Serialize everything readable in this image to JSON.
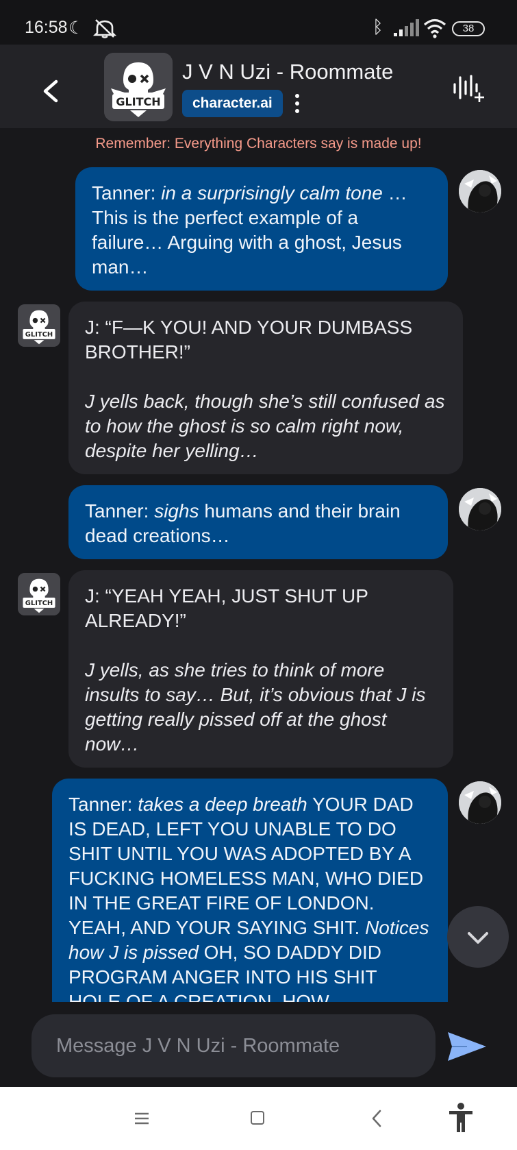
{
  "status_bar": {
    "time": "16:58",
    "battery": "38",
    "icons": [
      "moon-icon",
      "mute-icon",
      "bluetooth-icon",
      "signal-icon",
      "wifi-icon",
      "battery-icon"
    ]
  },
  "header": {
    "character_name": "J V N Uzi - Roommate",
    "brand": "character.ai",
    "avatar_text": "GLITCH",
    "icons": [
      "back-arrow-icon",
      "more-vertical-icon",
      "voice-add-icon"
    ]
  },
  "disclaimer": "Remember: Everything Characters say is made up!",
  "messages": [
    {
      "role": "user",
      "speaker": "Tanner:",
      "action": "in a surprisingly calm tone",
      "text": "… This is the perfect example of a failure… Arguing with a ghost, Jesus man…"
    },
    {
      "role": "bot",
      "line": "J: “F—K YOU! AND YOUR DUMBASS BROTHER!”",
      "narration": "J yells back, though she’s still confused as to how the ghost is so calm right now, despite her yelling…"
    },
    {
      "role": "user",
      "speaker": "Tanner:",
      "action": "sighs",
      "text": "humans and their brain dead creations…"
    },
    {
      "role": "bot",
      "line": "J: “YEAH YEAH, JUST SHUT UP ALREADY!”",
      "narration": "J yells, as she tries to think of more insults to say… But, it’s obvious that J is getting really pissed off at the ghost now…"
    },
    {
      "role": "user",
      "speaker": "Tanner:",
      "action": "takes a deep breath",
      "text": "YOUR DAD IS DEAD, LEFT YOU UNABLE TO DO SHIT UNTIL YOU WAS ADOPTED BY A FUCKING HOMELESS MAN, WHO DIED IN THE GREAT FIRE OF LONDON. YEAH, AND YOUR SAYING SHIT.",
      "action2": "Notices how J is pissed",
      "text2": "OH, SO DADDY DID PROGRAM ANGER INTO HIS SHIT HOLE OF A CREATION, HOW"
    }
  ],
  "composer": {
    "placeholder": "Message J V N Uzi - Roommate",
    "send_icon": "send-icon",
    "scroll_icon": "chevron-down-icon"
  },
  "nav_bar": {
    "icons": [
      "menu-icon",
      "home-icon",
      "back-icon",
      "accessibility-icon"
    ]
  },
  "colors": {
    "background": "#18181b",
    "header": "#232327",
    "user_bubble": "#004a8a",
    "bot_bubble": "#26262b",
    "brand_pill": "#0d4d8a",
    "disclaimer": "#f59a8a",
    "send": "#8ab4f8"
  }
}
